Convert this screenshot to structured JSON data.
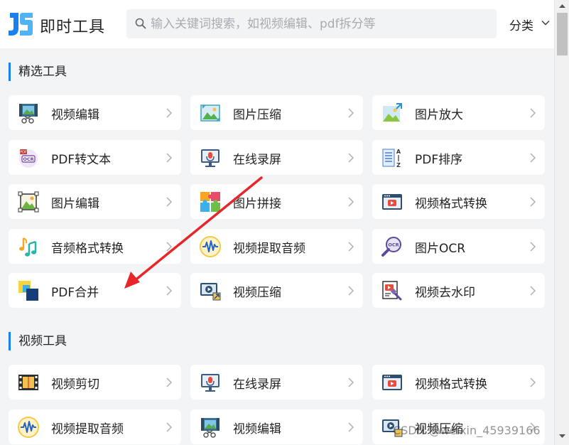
{
  "header": {
    "logo_text": "即时工具",
    "search_placeholder": "输入关键词搜索，如视频编辑、pdf拆分等",
    "category_label": "分类"
  },
  "sections": [
    {
      "title": "精选工具",
      "items": [
        {
          "label": "视频编辑",
          "icon": "video-edit-icon"
        },
        {
          "label": "图片压缩",
          "icon": "image-compress-icon"
        },
        {
          "label": "图片放大",
          "icon": "image-enlarge-icon"
        },
        {
          "label": "PDF转文本",
          "icon": "pdf-ocr-icon"
        },
        {
          "label": "在线录屏",
          "icon": "screen-record-icon"
        },
        {
          "label": "PDF排序",
          "icon": "pdf-sort-icon"
        },
        {
          "label": "图片编辑",
          "icon": "image-edit-icon"
        },
        {
          "label": "图片拼接",
          "icon": "image-puzzle-icon"
        },
        {
          "label": "视频格式转换",
          "icon": "video-format-icon"
        },
        {
          "label": "音频格式转换",
          "icon": "music-note-icon"
        },
        {
          "label": "视频提取音频",
          "icon": "audio-wave-icon"
        },
        {
          "label": "图片OCR",
          "icon": "ocr-magnifier-icon"
        },
        {
          "label": "PDF合并",
          "icon": "pdf-merge-icon"
        },
        {
          "label": "视频压缩",
          "icon": "video-compress-icon"
        },
        {
          "label": "视频去水印",
          "icon": "watermark-remove-icon"
        }
      ]
    },
    {
      "title": "视频工具",
      "items": [
        {
          "label": "视频剪切",
          "icon": "video-cut-icon"
        },
        {
          "label": "在线录屏",
          "icon": "screen-record-icon"
        },
        {
          "label": "视频格式转换",
          "icon": "video-format-icon"
        },
        {
          "label": "视频提取音频",
          "icon": "audio-wave-icon"
        },
        {
          "label": "视频编辑",
          "icon": "video-edit-icon"
        },
        {
          "label": "视频压缩",
          "icon": "video-compress-icon"
        }
      ]
    }
  ],
  "watermark": "CSDN @weixin_45939166",
  "colors": {
    "accent": "#1a7ff0",
    "annotation_arrow": "#e8262a"
  }
}
